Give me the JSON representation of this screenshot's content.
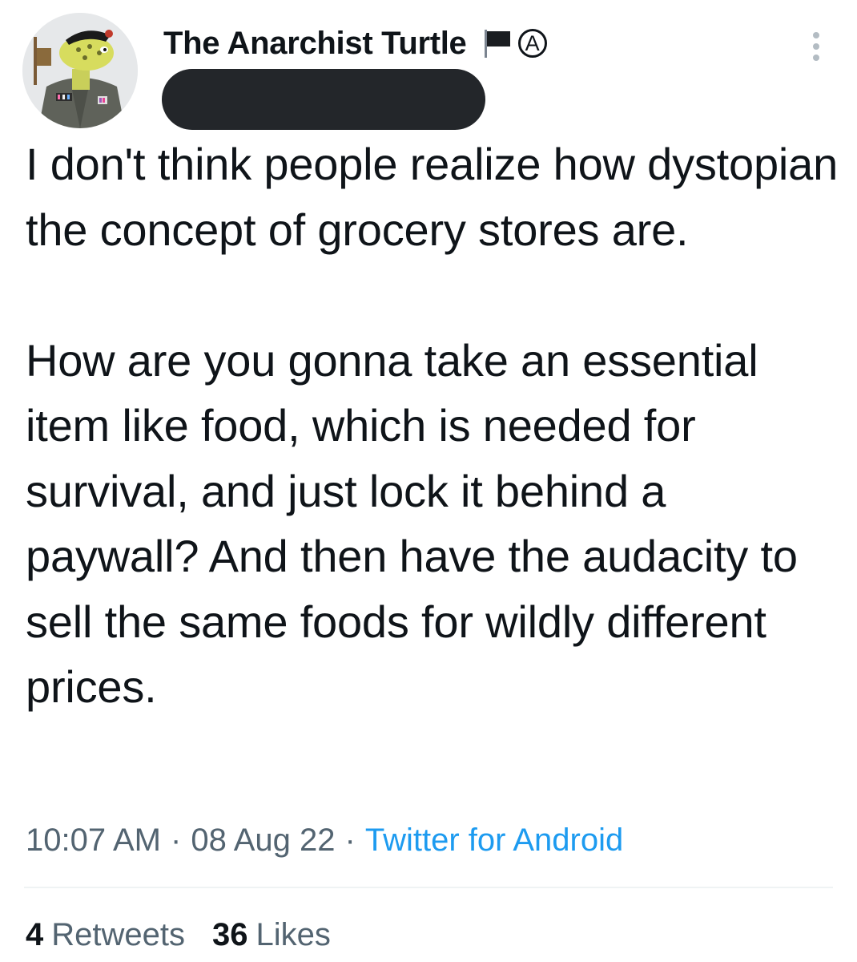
{
  "author": {
    "display_name": "The Anarchist Turtle",
    "avatar_icon": "turtle-avatar-icon",
    "badges": [
      "black-flag-icon",
      "circle-a-anarchy-icon"
    ],
    "anarchy_symbol": "A"
  },
  "tweet": {
    "paragraphs": [
      "I don't think people realize how dystopian the concept of grocery stores are.",
      "How are you gonna take an essential item like food, which is needed for survival, and just lock it behind a paywall? And then have the audacity to sell the same foods for wildly different prices."
    ]
  },
  "meta": {
    "time": "10:07 AM",
    "separator": "·",
    "date": "08 Aug 22",
    "source": "Twitter for Android"
  },
  "stats": {
    "retweets_count": "4",
    "retweets_label": "Retweets",
    "likes_count": "36",
    "likes_label": "Likes"
  },
  "colors": {
    "text": "#0f1419",
    "secondary": "#536471",
    "link": "#1d9bf0",
    "redaction": "#23262a"
  }
}
